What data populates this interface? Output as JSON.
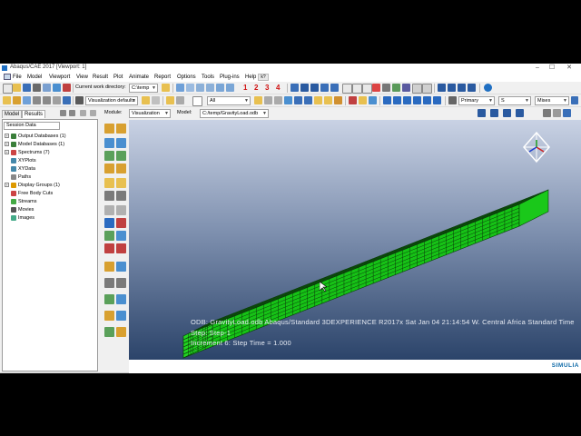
{
  "window": {
    "title": "Abaqus/CAE 2017 [Viewport: 1]",
    "controls": [
      "–",
      "☐",
      "✕"
    ]
  },
  "menubar": {
    "items": [
      "File",
      "Model",
      "Viewport",
      "View",
      "Result",
      "Plot",
      "Animate",
      "Report",
      "Options",
      "Tools",
      "Plug-ins",
      "Help"
    ],
    "help_extra": "k?"
  },
  "toolbar1": {
    "work_dir_label": "Current work directory:",
    "work_dir_value": "C:\\temp",
    "step_numbers": [
      "1",
      "2",
      "3",
      "4"
    ]
  },
  "toolbar2": {
    "visualization_defaults": "Visualization defaults",
    "all_label": "All"
  },
  "toolbar_right": {
    "primary": "Primary",
    "s_field": "S",
    "mises": "Mises"
  },
  "context": {
    "module_label": "Module:",
    "module_value": "Visualization",
    "model_label": "Model:",
    "model_value": "C:/temp/GravityLoad.odb"
  },
  "left_panel": {
    "tabs": [
      "Model",
      "Results"
    ],
    "session_combo": "Session Data",
    "tree": [
      {
        "label": "Output Databases (1)",
        "expand": "+",
        "icon_color": "#3a7f3a"
      },
      {
        "label": "Model Databases (1)",
        "expand": "+",
        "icon_color": "#3a7f3a"
      },
      {
        "label": "Spectrums (7)",
        "expand": "+",
        "icon_color": "#c44"
      },
      {
        "label": "XYPlots",
        "expand": "",
        "icon_color": "#48a"
      },
      {
        "label": "XYData",
        "expand": "",
        "icon_color": "#48a"
      },
      {
        "label": "Paths",
        "expand": "",
        "icon_color": "#888"
      },
      {
        "label": "Display Groups (1)",
        "expand": "+",
        "icon_color": "#d90"
      },
      {
        "label": "Free Body Cuts",
        "expand": "",
        "icon_color": "#c44"
      },
      {
        "label": "Streams",
        "expand": "",
        "icon_color": "#4a4"
      },
      {
        "label": "Movies",
        "expand": "",
        "icon_color": "#555"
      },
      {
        "label": "Images",
        "expand": "",
        "icon_color": "#4a8"
      }
    ]
  },
  "viewport": {
    "odb_line": "ODB: GravityLoad.odb    Abaqus/Standard 3DEXPERIENCE R2017x    Sat Jan 04 21:14:54 W. Central Africa Standard Time",
    "step_line": "Step: Step-1",
    "increment_line": "Increment    6: Step Time =    1.000",
    "axis": {
      "x": "X",
      "y": "Y",
      "z": "Z"
    },
    "mesh_color": "#1ecf1e",
    "edge_color": "#0a3a0a"
  },
  "branding": {
    "simulia": "SIMULIA"
  }
}
